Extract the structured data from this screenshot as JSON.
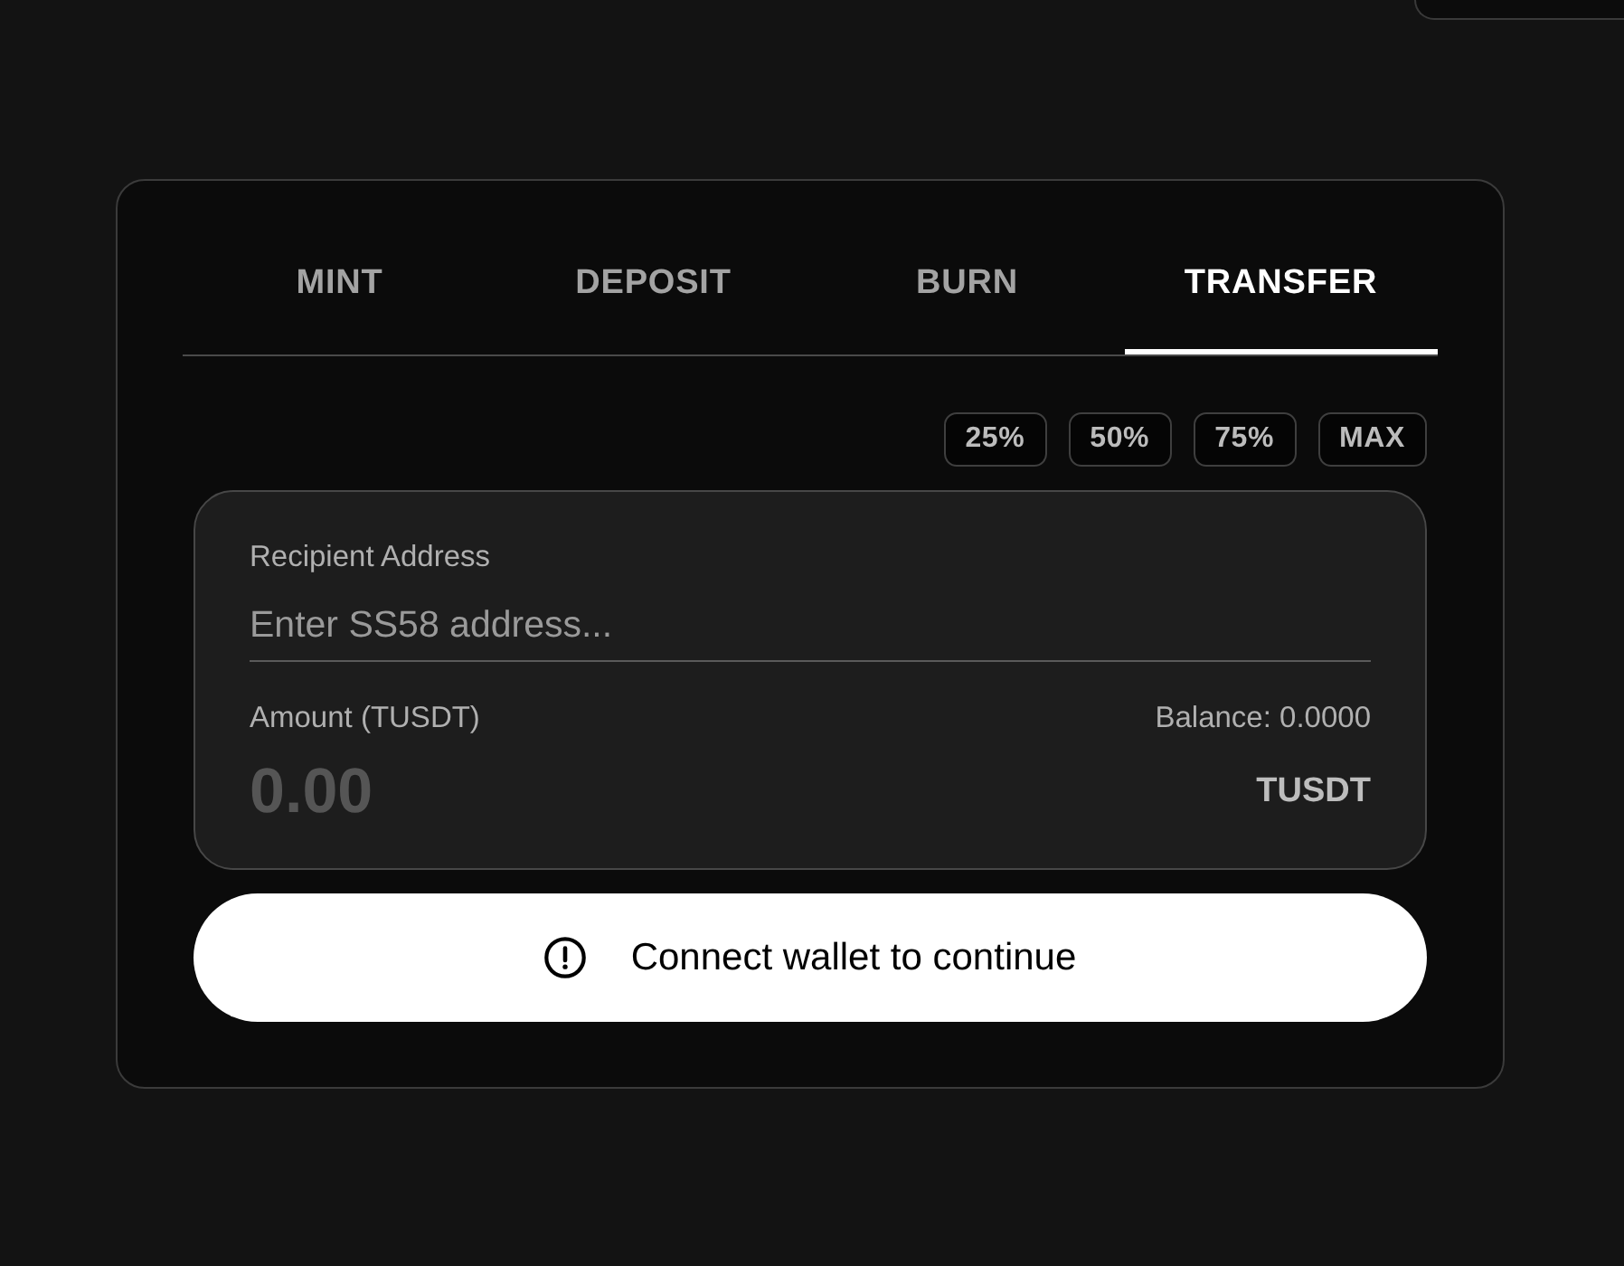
{
  "tabs": [
    {
      "label": "MINT",
      "selected": false
    },
    {
      "label": "DEPOSIT",
      "selected": false
    },
    {
      "label": "BURN",
      "selected": false
    },
    {
      "label": "TRANSFER",
      "selected": true
    }
  ],
  "amount_shortcuts": [
    "25%",
    "50%",
    "75%",
    "MAX"
  ],
  "recipient": {
    "label": "Recipient Address",
    "placeholder": "Enter SS58 address..."
  },
  "amount": {
    "label": "Amount (TUSDT)",
    "balance": "Balance: 0.0000",
    "placeholder": "0.00",
    "unit": "TUSDT"
  },
  "submit_button": {
    "label": "Connect wallet to continue"
  }
}
